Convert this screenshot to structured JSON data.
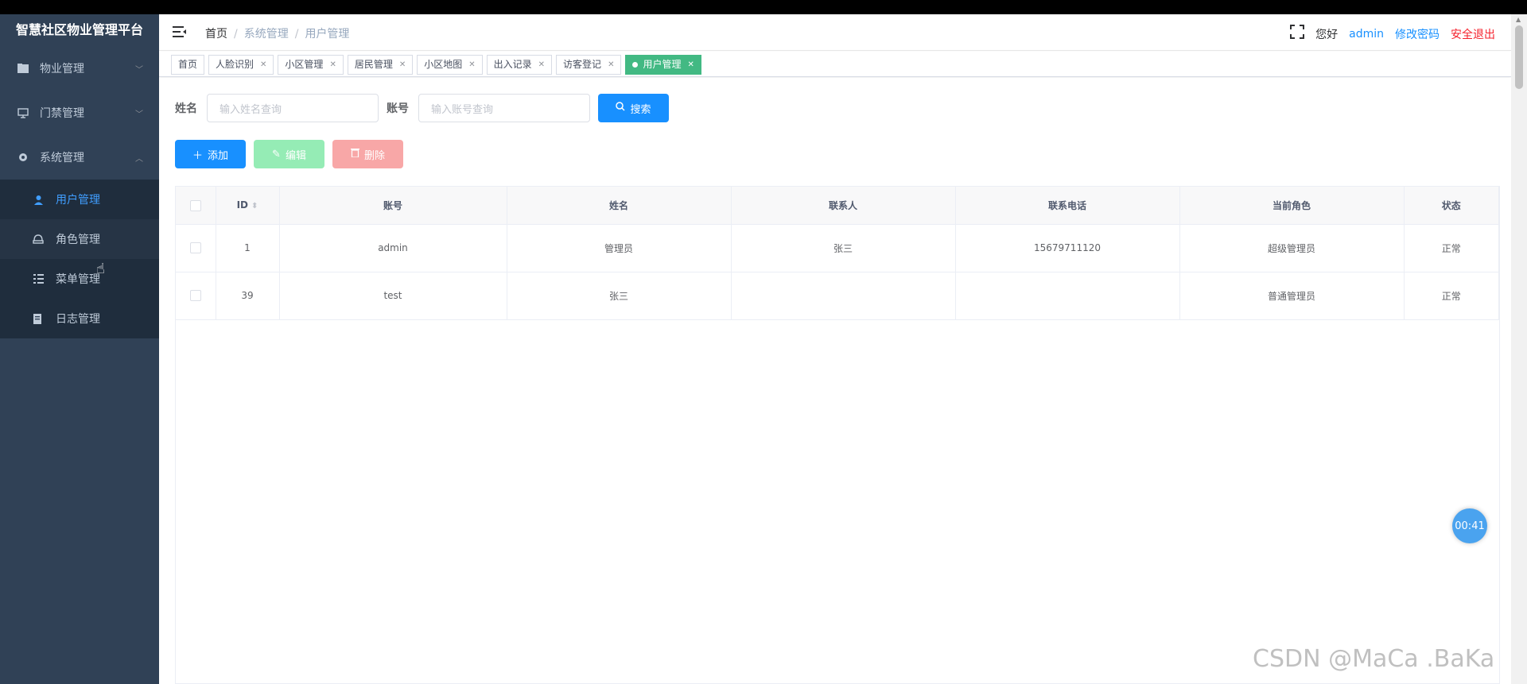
{
  "sidebar": {
    "logo": "智慧社区物业管理平台",
    "menus": [
      {
        "label": "物业管理",
        "icon": "folder-icon",
        "chevron": "﹀"
      },
      {
        "label": "门禁管理",
        "icon": "monitor-icon",
        "chevron": "﹀"
      },
      {
        "label": "系统管理",
        "icon": "gear-icon",
        "chevron": "︿"
      }
    ],
    "submenu": [
      {
        "label": "用户管理",
        "icon": "user-icon"
      },
      {
        "label": "角色管理",
        "icon": "role-icon"
      },
      {
        "label": "菜单管理",
        "icon": "list-icon"
      },
      {
        "label": "日志管理",
        "icon": "log-icon"
      }
    ]
  },
  "header": {
    "breadcrumb": [
      "首页",
      "系统管理",
      "用户管理"
    ],
    "greeting": "您好",
    "username": "admin",
    "change_password": "修改密码",
    "logout": "安全退出"
  },
  "tags": [
    {
      "label": "首页"
    },
    {
      "label": "人脸识别"
    },
    {
      "label": "小区管理"
    },
    {
      "label": "居民管理"
    },
    {
      "label": "小区地图"
    },
    {
      "label": "出入记录"
    },
    {
      "label": "访客登记"
    },
    {
      "label": "用户管理"
    }
  ],
  "search": {
    "name_label": "姓名",
    "name_placeholder": "输入姓名查询",
    "account_label": "账号",
    "account_placeholder": "输入账号查询",
    "search_button": "搜索"
  },
  "actions": {
    "add": "添加",
    "edit": "编辑",
    "delete": "删除"
  },
  "table": {
    "columns": [
      "ID",
      "账号",
      "姓名",
      "联系人",
      "联系电话",
      "当前角色",
      "状态"
    ],
    "rows": [
      {
        "id": "1",
        "account": "admin",
        "name": "管理员",
        "contact": "张三",
        "phone": "15679711120",
        "role": "超级管理员",
        "status": "正常"
      },
      {
        "id": "39",
        "account": "test",
        "name": "张三",
        "contact": "",
        "phone": "",
        "role": "普通管理员",
        "status": "正常"
      }
    ]
  },
  "timer": "00:41",
  "watermark": "CSDN @MaCa .BaKa",
  "colors": {
    "sidebar_bg": "#304156",
    "primary": "#1890ff",
    "active_tag": "#42b983"
  }
}
